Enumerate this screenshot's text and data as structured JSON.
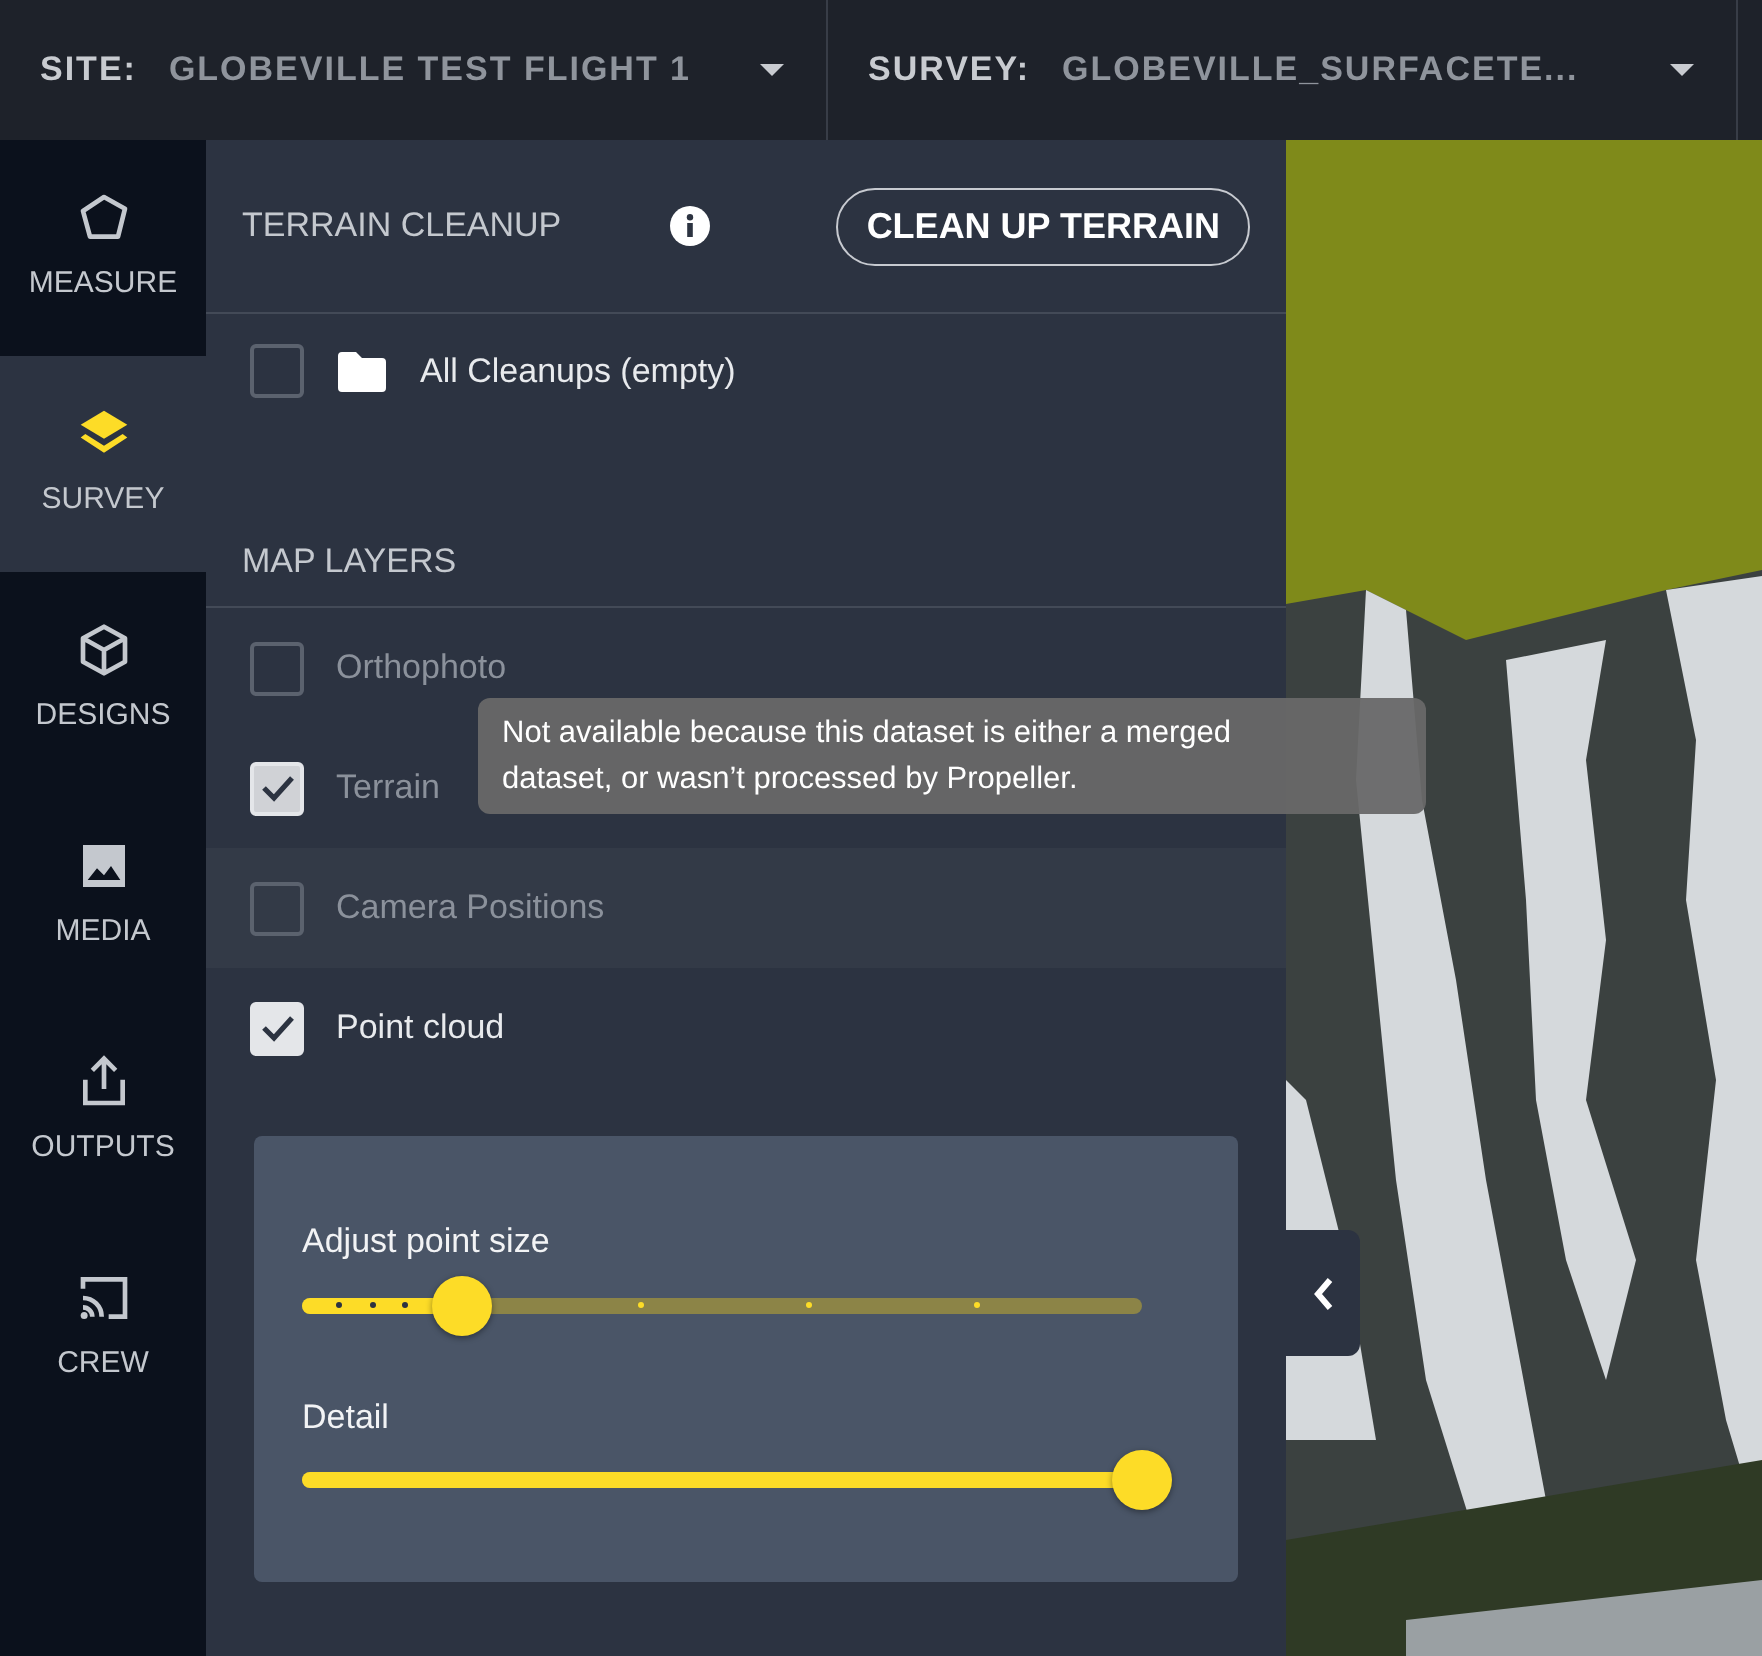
{
  "top_bar": {
    "site": {
      "label": "SITE:",
      "value": "GLOBEVILLE TEST FLIGHT 1"
    },
    "survey": {
      "label": "SURVEY:",
      "value": "GLOBEVILLE_SURFACETE..."
    }
  },
  "rail": [
    {
      "label": "MEASURE",
      "selected": false
    },
    {
      "label": "SURVEY",
      "selected": true
    },
    {
      "label": "DESIGNS",
      "selected": false
    },
    {
      "label": "MEDIA",
      "selected": false
    },
    {
      "label": "OUTPUTS",
      "selected": false
    },
    {
      "label": "CREW",
      "selected": false
    }
  ],
  "terrain_cleanup": {
    "title": "TERRAIN CLEANUP",
    "button": "CLEAN UP TERRAIN",
    "items": [
      {
        "label": "All Cleanups (empty)",
        "checked": false
      }
    ]
  },
  "map_layers": {
    "title": "MAP LAYERS",
    "layers": [
      {
        "label": "Orthophoto",
        "checked": false,
        "disabled": true,
        "hovered": false
      },
      {
        "label": "Terrain",
        "checked": true,
        "disabled": true,
        "hovered": false
      },
      {
        "label": "Camera Positions",
        "checked": false,
        "disabled": true,
        "hovered": true
      },
      {
        "label": "Point cloud",
        "checked": true,
        "disabled": false,
        "hovered": false
      }
    ]
  },
  "tooltip": "Not available because this dataset is either a merged dataset, or wasn’t processed by Propeller.",
  "point_cloud_settings": [
    {
      "label": "Adjust point size",
      "level": 0.19,
      "kind": "stepped"
    },
    {
      "label": "Detail",
      "level": 1.0,
      "kind": "continuous"
    }
  ]
}
